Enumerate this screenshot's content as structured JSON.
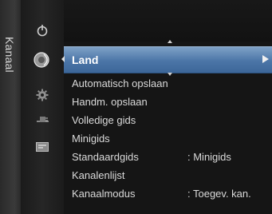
{
  "tab": {
    "label": "Kanaal"
  },
  "rail_icons": [
    {
      "name": "power-icon"
    },
    {
      "name": "satellite-dish-icon"
    },
    {
      "name": "gear-icon"
    },
    {
      "name": "plug-icon"
    },
    {
      "name": "input-source-icon"
    }
  ],
  "menu": {
    "selected": {
      "label": "Land"
    },
    "items": [
      {
        "label": "Automatisch opslaan",
        "value": ""
      },
      {
        "label": "Handm. opslaan",
        "value": ""
      },
      {
        "label": "Volledige gids",
        "value": ""
      },
      {
        "label": "Minigids",
        "value": ""
      },
      {
        "label": "Standaardgids",
        "value": ": Minigids"
      },
      {
        "label": "Kanalenlijst",
        "value": ""
      },
      {
        "label": "Kanaalmodus",
        "value": ": Toegev. kan."
      }
    ]
  },
  "colors": {
    "highlight": "#4b75a7",
    "background": "#151515",
    "text": "#dadada"
  }
}
